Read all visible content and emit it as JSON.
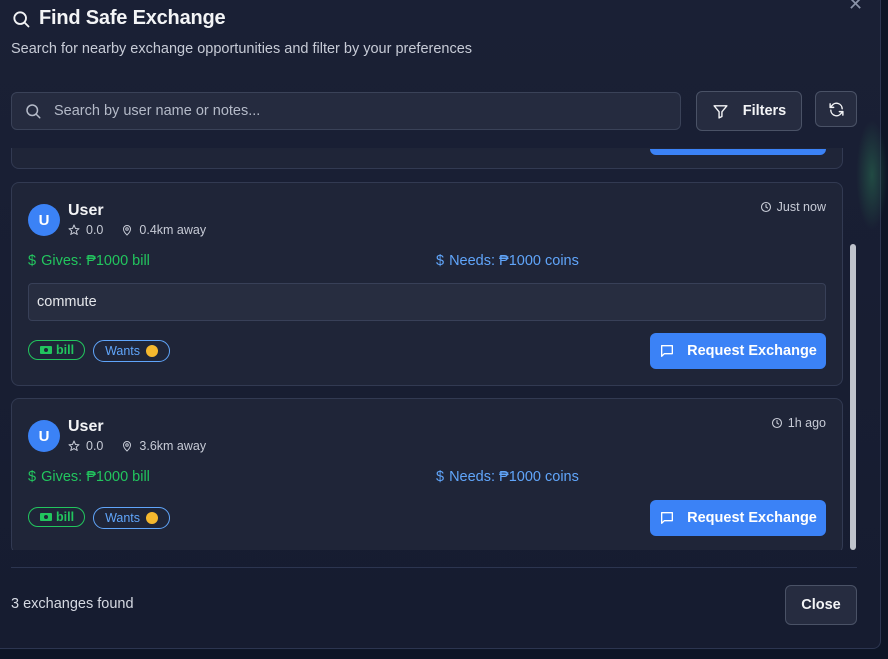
{
  "dialog": {
    "title": "Find Safe Exchange",
    "subtitle": "Search for nearby exchange opportunities and filter by your preferences"
  },
  "search": {
    "placeholder": "Search by user name or notes...",
    "value": ""
  },
  "toolbar": {
    "filters_label": "Filters"
  },
  "exchanges": [
    {
      "avatar_initial": "U",
      "user_name": "User",
      "rating": "0.0",
      "distance": "0.4km away",
      "time": "Just now",
      "gives": "Gives: ₱1000 bill",
      "needs": "Needs: ₱1000 coins",
      "note": "commute",
      "tag_gives": "bill",
      "tag_wants": "Wants",
      "request_label": "Request Exchange"
    },
    {
      "avatar_initial": "U",
      "user_name": "User",
      "rating": "0.0",
      "distance": "3.6km away",
      "time": "1h ago",
      "gives": "Gives: ₱1000 bill",
      "needs": "Needs: ₱1000 coins",
      "tag_gives": "bill",
      "tag_wants": "Wants",
      "request_label": "Request Exchange"
    }
  ],
  "footer": {
    "count_text": "3 exchanges found",
    "close_label": "Close"
  },
  "colors": {
    "accent": "#3b82f6",
    "gives": "#22c55e",
    "needs": "#60a5fa",
    "coin": "#f5b82e"
  }
}
